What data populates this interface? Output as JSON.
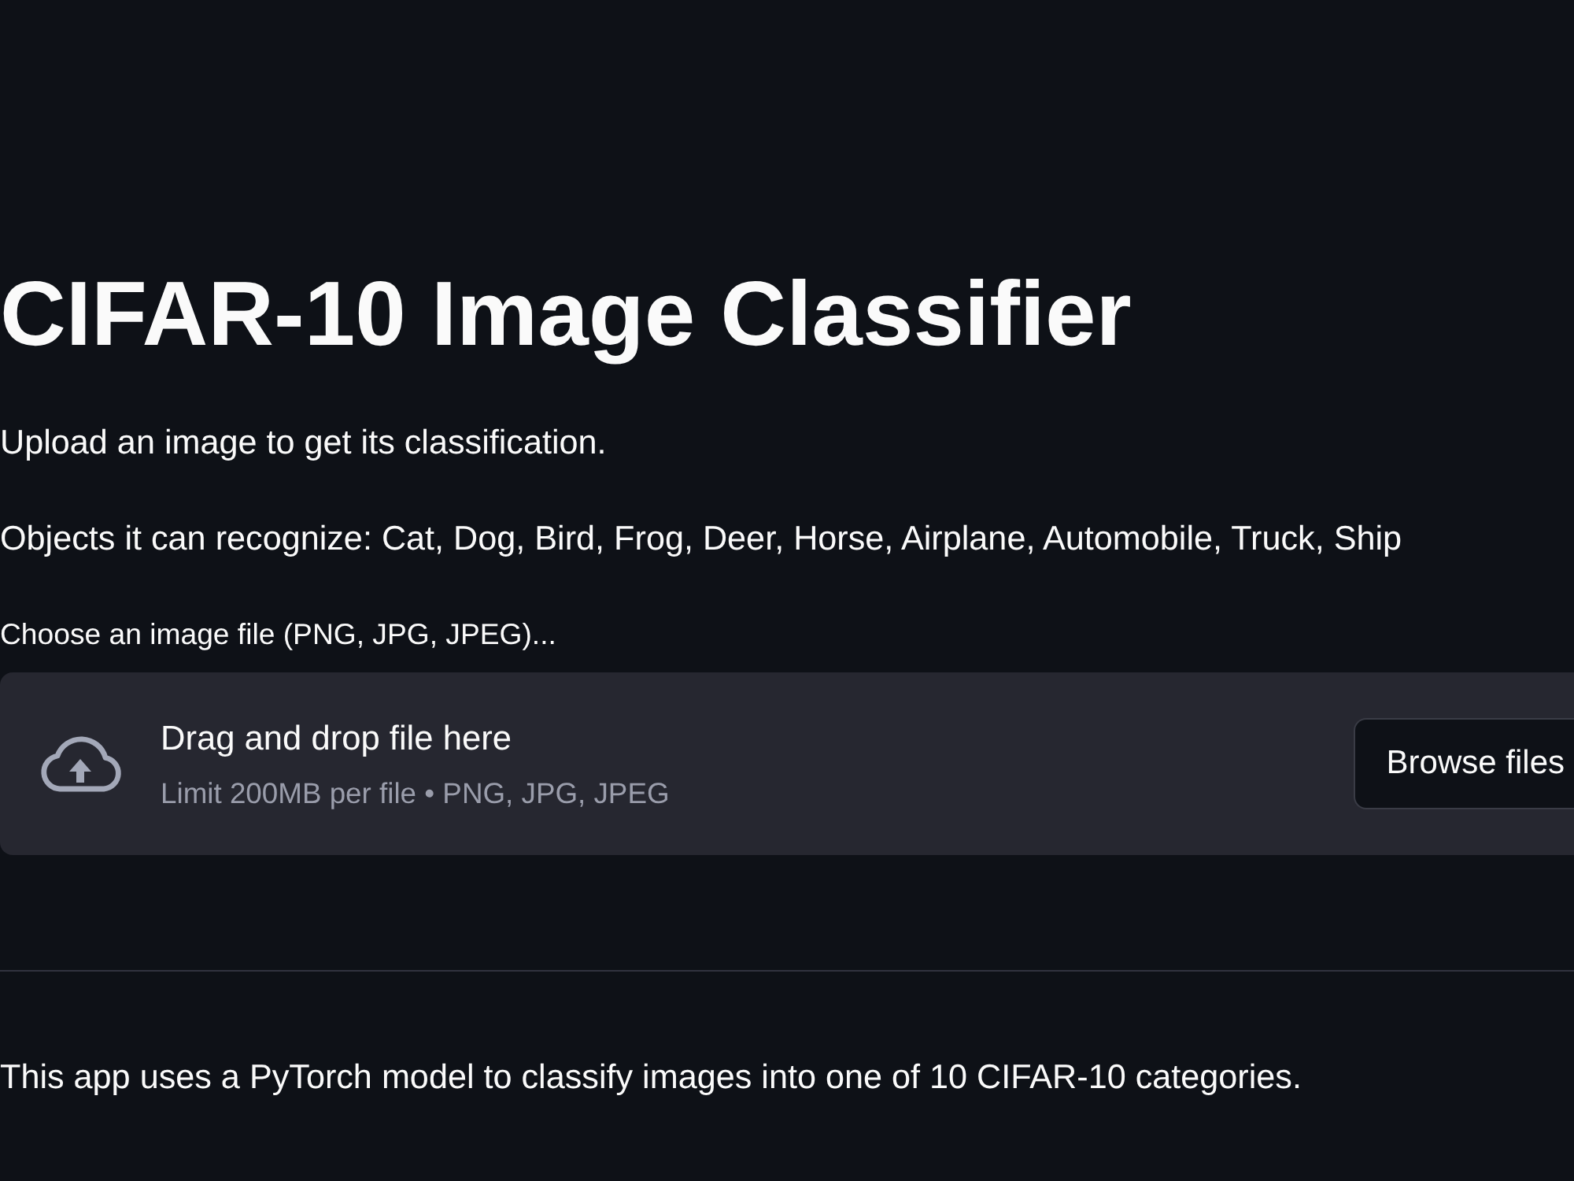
{
  "title": "CIFAR-10 Image Classifier",
  "paragraphs": [
    "Upload an image to get its classification.",
    "Objects it can recognize: Cat, Dog, Bird, Frog, Deer, Horse, Airplane, Automobile, Truck, Ship"
  ],
  "file_uploader": {
    "label": "Choose an image file (PNG, JPG, JPEG)...",
    "dropzone_text": "Drag and drop file here",
    "limit_text": "Limit 200MB per file • PNG, JPG, JPEG",
    "button": "Browse files"
  },
  "footer_text": "This app uses a PyTorch model to classify images into one of 10 CIFAR-10 categories."
}
